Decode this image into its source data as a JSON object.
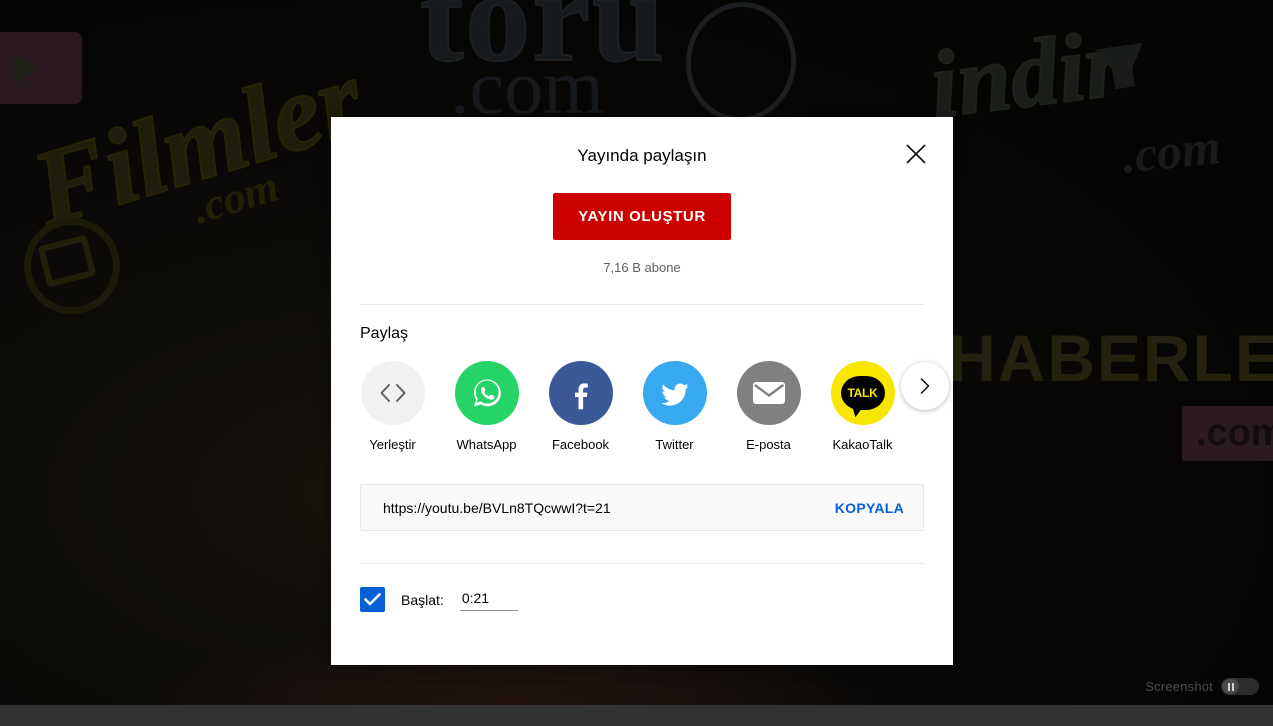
{
  "background": {
    "watermarks": [
      {
        "text": "Filmler",
        "kind": "chalk-logo"
      },
      {
        "text": ".com",
        "kind": "chalk-logo-suffix"
      },
      {
        "text": "toru",
        "kind": "chalk-logo"
      },
      {
        "text": ".com",
        "kind": "chalk-logo-suffix"
      },
      {
        "text": "indir",
        "kind": "chalk-logo"
      },
      {
        "text": ".com",
        "kind": "chalk-logo-suffix"
      },
      {
        "text": "HABERLER",
        "kind": "chalk-logo"
      },
      {
        "text": ".com",
        "kind": "chalk-logo-badge"
      }
    ]
  },
  "overlay": {
    "screenshot_label": "Screenshot",
    "toggle_icon": "pause-icon"
  },
  "dialog": {
    "title": "Yayında paylaşın",
    "close_icon": "close-icon",
    "live_button": "YAYIN OLUŞTUR",
    "subscriber_count": "7,16 B abone",
    "share_heading": "Paylaş",
    "next_icon": "chevron-right-icon",
    "share_targets": [
      {
        "label": "Yerleştir",
        "icon": "code-brackets-icon",
        "color": "#f1f1f1"
      },
      {
        "label": "WhatsApp",
        "icon": "whatsapp-icon",
        "color": "#25d366"
      },
      {
        "label": "Facebook",
        "icon": "facebook-icon",
        "color": "#3b5998"
      },
      {
        "label": "Twitter",
        "icon": "twitter-icon",
        "color": "#36a9f0"
      },
      {
        "label": "E-posta",
        "icon": "envelope-icon",
        "color": "#808080"
      },
      {
        "label": "KakaoTalk",
        "icon": "kakaotalk-icon",
        "color": "#f7e600",
        "glyph": "TALK"
      }
    ],
    "url": "https://youtu.be/BVLn8TQcwwI?t=21",
    "copy_label": "KOPYALA",
    "start_label": "Başlat:",
    "start_time": "0:21",
    "start_checked": true,
    "accent_color": "#065fd4",
    "brand_color": "#cc0000"
  }
}
